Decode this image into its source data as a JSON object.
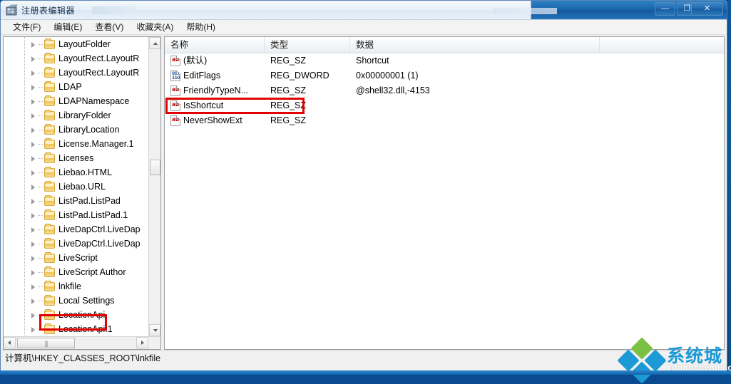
{
  "window": {
    "title": "注册表编辑器",
    "icon": "regedit-icon",
    "controls": {
      "minimize_label": "—",
      "maximize_label": "❐",
      "close_label": "✕"
    }
  },
  "menubar": {
    "items": [
      {
        "label": "文件(F)",
        "name": "menu-file"
      },
      {
        "label": "编辑(E)",
        "name": "menu-edit"
      },
      {
        "label": "查看(V)",
        "name": "menu-view"
      },
      {
        "label": "收藏夹(A)",
        "name": "menu-favorites"
      },
      {
        "label": "帮助(H)",
        "name": "menu-help"
      }
    ]
  },
  "tree": {
    "highlighted_key": "lnkfile",
    "highlight_color": "#e00000",
    "items": [
      {
        "label": "LayoutFolder"
      },
      {
        "label": "LayoutRect.LayoutR"
      },
      {
        "label": "LayoutRect.LayoutR"
      },
      {
        "label": "LDAP"
      },
      {
        "label": "LDAPNamespace"
      },
      {
        "label": "LibraryFolder"
      },
      {
        "label": "LibraryLocation"
      },
      {
        "label": "License.Manager.1"
      },
      {
        "label": "Licenses"
      },
      {
        "label": "Liebao.HTML"
      },
      {
        "label": "Liebao.URL"
      },
      {
        "label": "ListPad.ListPad"
      },
      {
        "label": "ListPad.ListPad.1"
      },
      {
        "label": "LiveDapCtrl.LiveDap"
      },
      {
        "label": "LiveDapCtrl.LiveDap"
      },
      {
        "label": "LiveScript"
      },
      {
        "label": "LiveScript Author"
      },
      {
        "label": "lnkfile"
      },
      {
        "label": "Local Settings"
      },
      {
        "label": "LocationApi"
      },
      {
        "label": "LocationApi.1"
      }
    ]
  },
  "list": {
    "columns": [
      {
        "label": "名称"
      },
      {
        "label": "类型"
      },
      {
        "label": "数据"
      }
    ],
    "highlighted_row": "IsShortcut",
    "highlight_color": "#e00000",
    "rows": [
      {
        "name": "(默认)",
        "type": "REG_SZ",
        "data": "Shortcut",
        "icon": "reg-sz-icon"
      },
      {
        "name": "EditFlags",
        "type": "REG_DWORD",
        "data": "0x00000001 (1)",
        "icon": "reg-dword-icon"
      },
      {
        "name": "FriendlyTypeN...",
        "type": "REG_SZ",
        "data": "@shell32.dll,-4153",
        "icon": "reg-sz-icon"
      },
      {
        "name": "IsShortcut",
        "type": "REG_SZ",
        "data": "",
        "icon": "reg-sz-icon"
      },
      {
        "name": "NeverShowExt",
        "type": "REG_SZ",
        "data": "",
        "icon": "reg-sz-icon"
      }
    ]
  },
  "statusbar": {
    "path": "计算机\\HKEY_CLASSES_ROOT\\lnkfile"
  },
  "watermark": {
    "brand_cn": "系统城",
    "url": "xitongcheng.com"
  }
}
